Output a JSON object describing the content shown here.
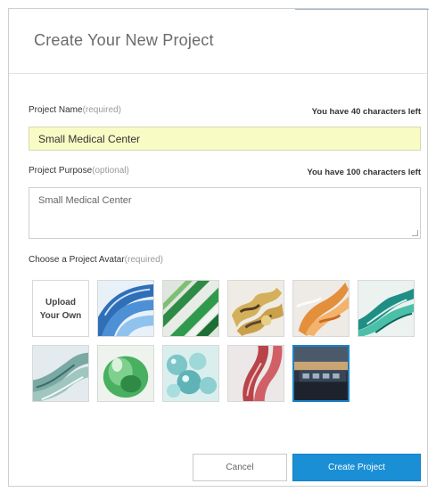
{
  "dialog": {
    "title": "Create Your New Project"
  },
  "project_name": {
    "label": "Project Name",
    "qualifier": "(required)",
    "counter": "You have 40 characters left",
    "value": "Small Medical Center"
  },
  "project_purpose": {
    "label": "Project Purpose",
    "qualifier": "(optional)",
    "counter": "You have 100 characters left",
    "value": "Small Medical Center"
  },
  "avatar": {
    "label": "Choose a Project Avatar",
    "qualifier": "(required)",
    "upload_line1": "Upload",
    "upload_line2": "Your Own"
  },
  "buttons": {
    "cancel": "Cancel",
    "create": "Create Project"
  },
  "colors": {
    "accent": "#1b8fd6",
    "name_field_bg": "#f9fbc4"
  }
}
